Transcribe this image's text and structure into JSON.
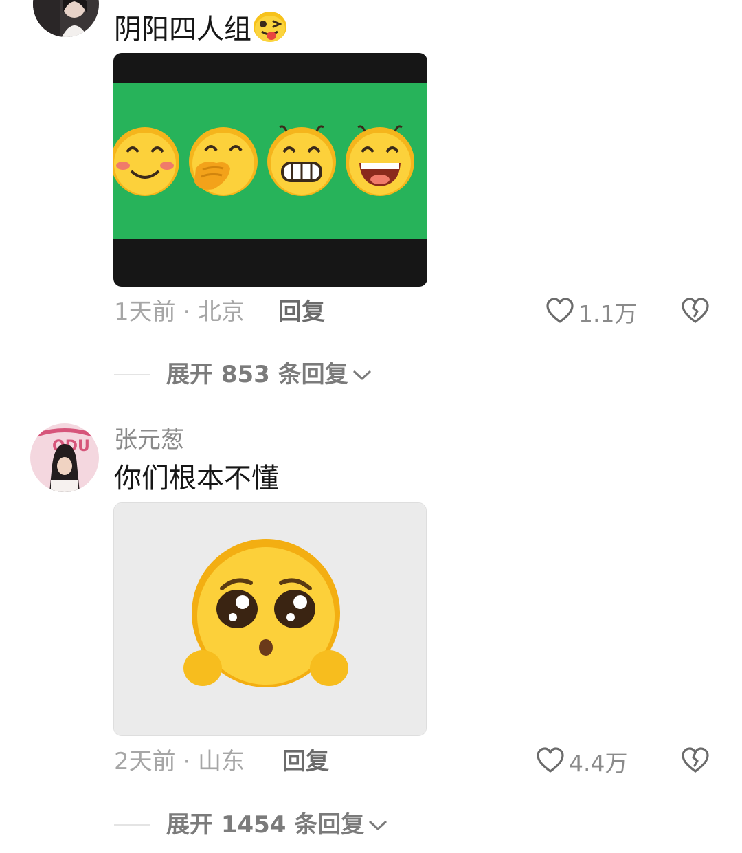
{
  "comments": [
    {
      "username": "",
      "text": "阴阳四人组",
      "inline_emoji": "winking-tongue-emoji",
      "image": {
        "background": "#27b35a",
        "bar_color": "#161616",
        "emojis": [
          "blushing-smile-emoji",
          "covering-mouth-emoji",
          "grinning-teeth-emoji",
          "laughing-emoji"
        ]
      },
      "time_location": "1天前 · 北京",
      "reply_label": "回复",
      "like_count": "1.1万",
      "expand_label": "展开 853 条回复"
    },
    {
      "username": "张元葱",
      "text": "你们根本不懂",
      "image": {
        "background": "#ebebeb",
        "emoji": "pleading-face-emoji"
      },
      "time_location": "2天前 · 山东",
      "reply_label": "回复",
      "like_count": "4.4万",
      "expand_label": "展开 1454 条回复"
    }
  ],
  "icons": {
    "like": "heart-outline-icon",
    "dislike": "broken-heart-icon",
    "expand": "chevron-down-icon"
  },
  "colors": {
    "meta_text": "#a6a6a6",
    "reply_text": "#6b6b6b",
    "green": "#27b35a"
  }
}
